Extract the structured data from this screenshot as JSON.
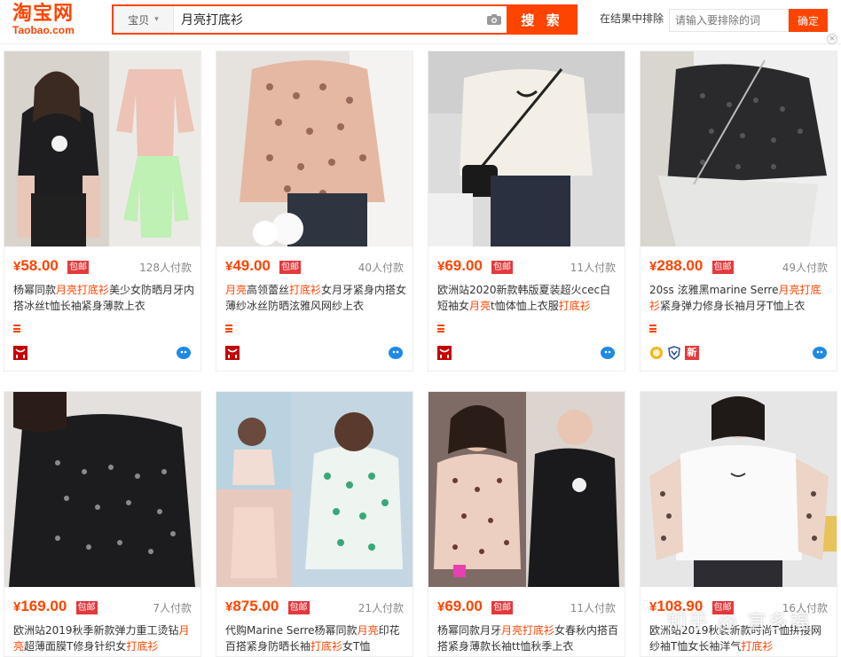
{
  "header": {
    "logo_zh": "淘宝网",
    "logo_en": "Taobao.com",
    "category": "宝贝",
    "query": "月亮打底衫",
    "search_label": "搜 索",
    "exclude_label": "在结果中排除",
    "exclude_placeholder": "请输入要排除的词",
    "confirm_label": "确定",
    "close_glyph": "×"
  },
  "colors": {
    "accent": "#ff4400",
    "tag_red": "#e4393c"
  },
  "tag_label": "包邮",
  "products": [
    {
      "price_symbol": "¥",
      "price": "58.00",
      "sales": "128人付款",
      "title": [
        {
          "t": "杨幂同款"
        },
        {
          "t": "月亮打底衫",
          "hl": true
        },
        {
          "t": "美少女防晒月牙内搭冰丝t恤长袖紧身薄款上衣"
        }
      ]
    },
    {
      "price_symbol": "¥",
      "price": "49.00",
      "sales": "40人付款",
      "title": [
        {
          "t": "月亮",
          "hl": true
        },
        {
          "t": "高领蕾丝"
        },
        {
          "t": "打底衫",
          "hl": true
        },
        {
          "t": "女月牙紧身内搭女薄纱冰丝防晒泫雅风网纱上衣"
        }
      ]
    },
    {
      "price_symbol": "¥",
      "price": "69.00",
      "sales": "11人付款",
      "title": [
        {
          "t": "欧洲站2020新款韩版夏装超火cec白短袖女"
        },
        {
          "t": "月亮",
          "hl": true
        },
        {
          "t": "t恤体恤上衣服"
        },
        {
          "t": "打底衫",
          "hl": true
        }
      ]
    },
    {
      "price_symbol": "¥",
      "price": "288.00",
      "sales": "49人付款",
      "title": [
        {
          "t": "20ss 泫雅黑marine Serre"
        },
        {
          "t": "月亮打底衫",
          "hl": true
        },
        {
          "t": "紧身弹力修身长袖月牙T恤上衣"
        }
      ]
    },
    {
      "price_symbol": "¥",
      "price": "169.00",
      "sales": "7人付款",
      "title": [
        {
          "t": "欧洲站2019秋季新款弹力重工烫钻"
        },
        {
          "t": "月亮",
          "hl": true
        },
        {
          "t": "超薄面膜T修身针织女"
        },
        {
          "t": "打底衫",
          "hl": true
        }
      ]
    },
    {
      "price_symbol": "¥",
      "price": "875.00",
      "sales": "21人付款",
      "title": [
        {
          "t": "代购Marine Serre杨幂同款"
        },
        {
          "t": "月亮",
          "hl": true
        },
        {
          "t": "印花百搭紧身防晒长袖"
        },
        {
          "t": "打底衫",
          "hl": true
        },
        {
          "t": "女T恤"
        }
      ]
    },
    {
      "price_symbol": "¥",
      "price": "69.00",
      "sales": "11人付款",
      "title": [
        {
          "t": "杨幂同款月牙"
        },
        {
          "t": "月亮打底衫",
          "hl": true
        },
        {
          "t": "女春秋内搭百搭紧身薄款长袖tt恤秋季上衣"
        }
      ]
    },
    {
      "price_symbol": "¥",
      "price": "108.90",
      "sales": "16人付款",
      "title": [
        {
          "t": "欧洲站2019秋装新款时尚T恤拼接网纱袖T恤女长袖洋气"
        },
        {
          "t": "打底衫",
          "hl": true
        }
      ]
    }
  ],
  "shop_badges": {
    "new": "新"
  },
  "watermark": "知乎 @ 宣多福"
}
